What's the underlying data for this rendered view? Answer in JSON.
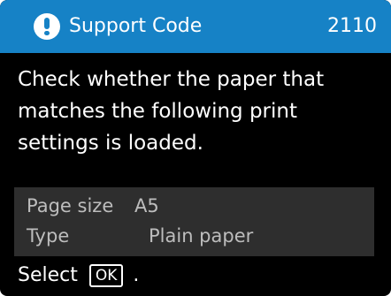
{
  "header": {
    "title": "Support Code",
    "code": "2110",
    "icon": "exclamation-circle-icon",
    "background_color": "#1682c6"
  },
  "message": "Check whether the paper that matches the following print settings is loaded.",
  "settings": [
    {
      "label": "Page size",
      "value": "A5"
    },
    {
      "label": "Type",
      "value": "Plain paper"
    }
  ],
  "footer": {
    "prefix": "Select",
    "button_label": "OK",
    "suffix": "."
  }
}
